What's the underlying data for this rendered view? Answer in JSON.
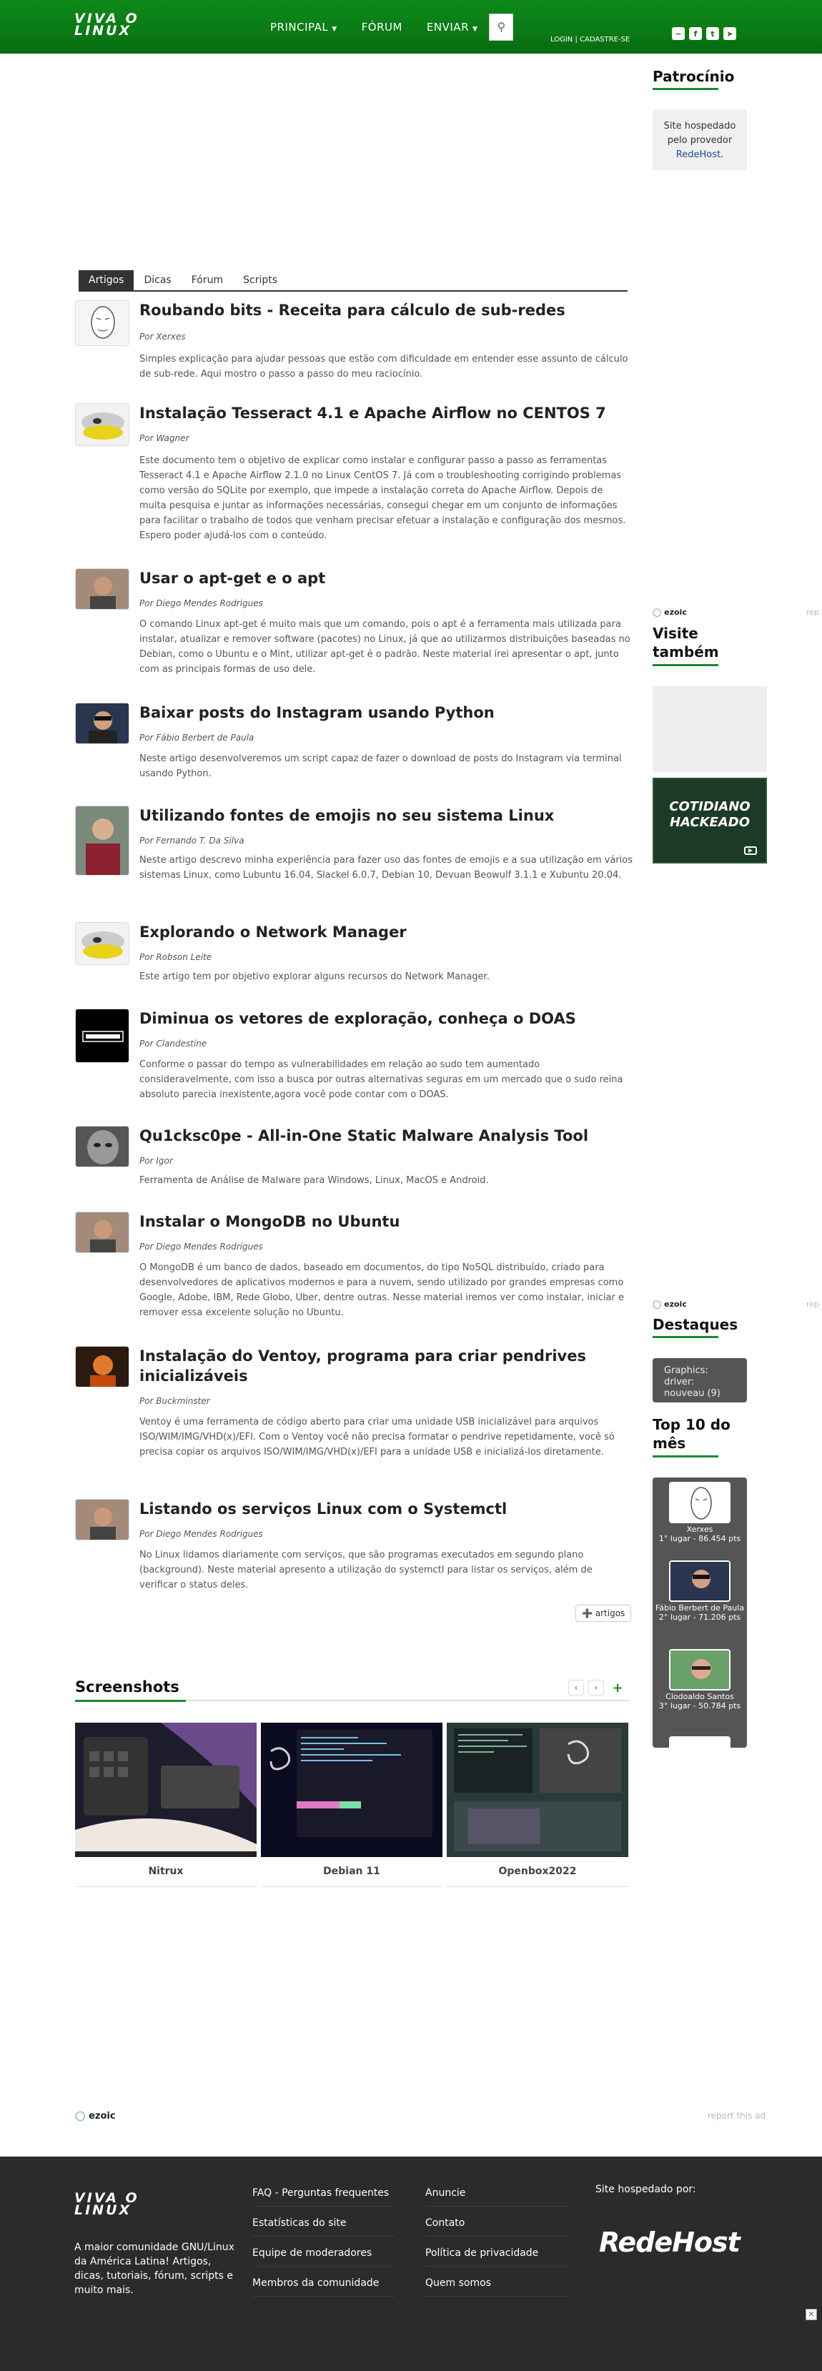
{
  "header": {
    "logo": [
      "VIVA O",
      "LINUX"
    ],
    "nav": [
      {
        "label": "PRINCIPAL",
        "caret": true
      },
      {
        "label": "FÓRUM",
        "caret": false
      },
      {
        "label": "ENVIAR",
        "caret": true
      }
    ],
    "login": "LOGIN",
    "signup": "CADASTRE-SE",
    "socials": [
      "rss-icon",
      "facebook-icon",
      "twitter-icon",
      "telegram-icon"
    ]
  },
  "tabs": [
    "Artigos",
    "Dicas",
    "Fórum",
    "Scripts"
  ],
  "articles": [
    {
      "title": "Roubando bits - Receita para cálculo de sub-redes",
      "author": "Por Xerxes",
      "desc": "Simples explicação para ajudar pessoas que estão com dificuldade em entender esse assunto de cálculo de sub-rede. Aqui mostro o passo a passo do meu raciocínio."
    },
    {
      "title": "Instalação Tesseract 4.1 e Apache Airflow no CENTOS 7",
      "author": "Por Wagner",
      "desc": "Este documento tem o objetivo de explicar como instalar e configurar passo a passo as ferramentas Tesseract 4.1 e Apache Airflow 2.1.0 no Linux CentOS 7. Já com o troubleshooting corrigindo problemas como versão do SQLite por exemplo, que impede a instalação correta do Apache Airflow. Depois de muita pesquisa e juntar as informações necessárias, consegui chegar em um conjunto de informações para facilitar o trabalho de todos que venham precisar efetuar a instalação e configuração dos mesmos. Espero poder ajudá-los com o conteúdo."
    },
    {
      "title": "Usar o apt-get e o apt",
      "author": "Por Diego Mendes Rodrigues",
      "desc": "O comando Linux apt-get é muito mais que um comando, pois o apt é a ferramenta mais utilizada para instalar, atualizar e remover software (pacotes) no Linux, já que ao utilizarmos distribuições baseadas no Debian, como o Ubuntu e o Mint, utilizar apt-get é o padrão. Neste material irei apresentar o apt, junto com as principais formas de uso dele."
    },
    {
      "title": "Baixar posts do Instagram usando Python",
      "author": "Por Fábio Berbert de Paula",
      "desc": "Neste artigo desenvolveremos um script capaz de fazer o download de posts do Instagram via terminal usando Python."
    },
    {
      "title": "Utilizando fontes de emojis no seu sistema Linux",
      "author": "Por Fernando T. Da Silva",
      "desc": "Neste artigo descrevo minha experiência para fazer uso das fontes de emojis e a sua utilização em vários sistemas Linux, como Lubuntu 16.04, Slackel 6.0.7, Debian 10, Devuan Beowulf 3.1.1 e Xubuntu 20.04."
    },
    {
      "title": "Explorando o Network Manager",
      "author": "Por Robson Leite",
      "desc": "Este artigo tem por objetivo explorar alguns recursos do Network Manager."
    },
    {
      "title": "Diminua os vetores de exploração, conheça o DOAS",
      "author": "Por Clandestine",
      "desc": "Conforme o passar do tempo as vulnerabilidades em relação ao sudo tem aumentado consideravelmente, com isso a busca por outras alternativas seguras em um mercado que o sudo reina absoluto parecia inexistente,agora você pode contar com o DOAS."
    },
    {
      "title": "Qu1cksc0pe - All-in-One Static Malware Analysis Tool",
      "author": "Por Igor",
      "desc": "Ferramenta de Análise de Malware para Windows, Linux, MacOS e Android."
    },
    {
      "title": "Instalar o MongoDB no Ubuntu",
      "author": "Por Diego Mendes Rodrigues",
      "desc": "O MongoDB é um banco de dados, baseado em documentos, do tipo NoSQL distribuído, criado para desenvolvedores de aplicativos modernos e para a nuvem, sendo utilizado por grandes empresas como Google, Adobe, IBM, Rede Globo, Uber, dentre outras. Nesse material iremos ver como instalar, iniciar e remover essa excelente solução no Ubuntu."
    },
    {
      "title": "Instalação do Ventoy, programa para criar pendrives inicializáveis",
      "author": "Por Buckminster",
      "desc": "Ventoy é uma ferramenta de código aberto para criar uma unidade USB inicializável para arquivos ISO/WIM/IMG/VHD(x)/EFI. Com o Ventoy você não precisa formatar o pendrive repetidamente, você só precisa copiar os arquivos ISO/WIM/IMG/VHD(x)/EFI para a unidade USB e inicializá-los diretamente."
    },
    {
      "title": "Listando os serviços Linux com o Systemctl",
      "author": "Por Diego Mendes Rodrigues",
      "desc": "No Linux lidamos diariamente com serviços, que são programas executados em segundo plano (background). Neste material apresento a utilização do systemctl para listar os serviços, além de verificar o status deles."
    }
  ],
  "more_button": "artigos",
  "sidebar": {
    "sponsor_title": "Patrocínio",
    "sponsor_text": "Site hospedado pelo provedor",
    "sponsor_link": "RedeHost",
    "sponsor_dot": ".",
    "ezoic": "ezoic",
    "report": "rep",
    "visite_title": "Visite também",
    "banner_text": "COTIDIANO HACKEADO",
    "destaques_title": "Destaques",
    "destaque_item": "Graphics: driver: nouveau (9)",
    "top10_title": "Top 10 do mês",
    "top10": [
      {
        "name": "Xerxes",
        "rank": "1° lugar - 86.454 pts"
      },
      {
        "name": "Fábio Berbert de Paula",
        "rank": "2° lugar - 71.206 pts"
      },
      {
        "name": "Clodoaldo Santos",
        "rank": "3° lugar - 50.784 pts"
      }
    ]
  },
  "screenshots": {
    "title": "Screenshots",
    "items": [
      "Nitrux",
      "Debian 11",
      "Openbox2022"
    ]
  },
  "bottom_ad": {
    "ezoic": "ezoic",
    "report": "report this ad"
  },
  "footer": {
    "logo": [
      "VIVA O",
      "LINUX"
    ],
    "tagline": "A maior comunidade GNU/Linux da América Latina! Artigos, dicas, tutoriais, fórum, scripts e muito mais.",
    "col1": [
      "FAQ - Perguntas frequentes",
      "Estatísticas do site",
      "Equipe de moderadores",
      "Membros da comunidade"
    ],
    "col2": [
      "Anuncie",
      "Contato",
      "Política de privacidade",
      "Quem somos"
    ],
    "host_label": "Site hospedado por:",
    "host_brand": "RedeHost"
  },
  "colors": {
    "brand_green": "#0a7a15",
    "accent_underline": "#1a8a2a",
    "footer_bg": "#2b2b2b"
  }
}
